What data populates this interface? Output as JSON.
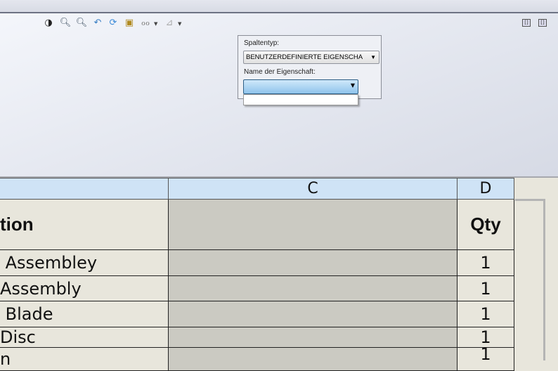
{
  "toolbar": {
    "icons": [
      "section-view-icon",
      "zoom-to-fit-icon",
      "zoom-to-area-icon",
      "previous-view-icon",
      "rebuild-icon",
      "options-icon",
      "hide-show-icon",
      "apply-scene-icon"
    ]
  },
  "window_buttons": [
    "restore-left",
    "restore-right"
  ],
  "panel": {
    "column_type_label": "Spaltentyp:",
    "column_type_value": "BENUTZERDEFINIERTE EIGENSCHA",
    "property_name_label": "Name der Eigenschaft:",
    "property_name_value": ""
  },
  "table": {
    "column_headers": [
      "",
      "C",
      "D"
    ],
    "rows": [
      {
        "description": "tion",
        "c": "",
        "qty": "Qty"
      },
      {
        "description": " Assembley",
        "c": "",
        "qty": "1"
      },
      {
        "description": "Assembly",
        "c": "",
        "qty": "1"
      },
      {
        "description": " Blade",
        "c": "",
        "qty": "1"
      },
      {
        "description": "Disc",
        "c": "",
        "qty": "1"
      },
      {
        "description": "n",
        "c": "",
        "qty": "1"
      }
    ]
  }
}
